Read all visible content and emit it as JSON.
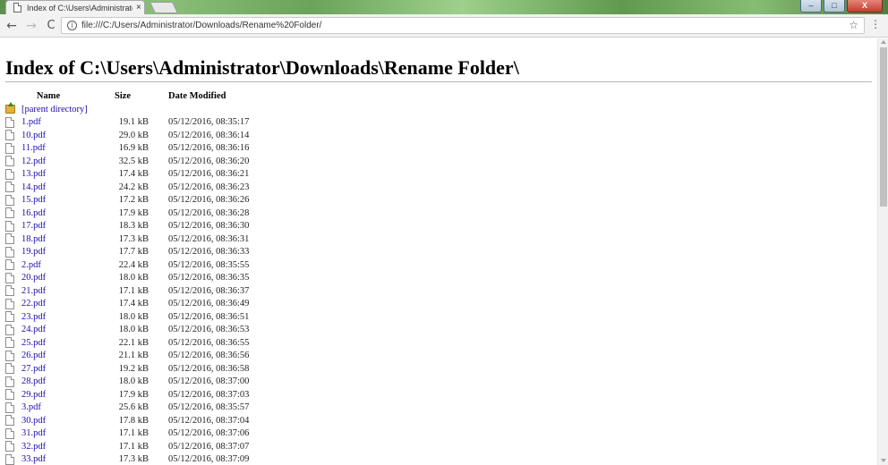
{
  "browser": {
    "tab_title": "Index of C:\\Users\\Administrator",
    "tab_close": "×",
    "url": "file:///C:/Users/Administrator/Downloads/Rename%20Folder/",
    "back": "←",
    "forward": "→",
    "reload": "C",
    "info": "i",
    "star": "☆",
    "menu": "⋮",
    "controls": {
      "minimize": "–",
      "maximize": "□",
      "close": "X"
    }
  },
  "page": {
    "heading": "Index of C:\\Users\\Administrator\\Downloads\\Rename Folder\\",
    "columns": {
      "name": "Name",
      "size": "Size",
      "date": "Date Modified"
    },
    "parent_link": "[parent directory]",
    "files": [
      {
        "name": "1.pdf",
        "size": "19.1 kB",
        "date": "05/12/2016, 08:35:17"
      },
      {
        "name": "10.pdf",
        "size": "29.0 kB",
        "date": "05/12/2016, 08:36:14"
      },
      {
        "name": "11.pdf",
        "size": "16.9 kB",
        "date": "05/12/2016, 08:36:16"
      },
      {
        "name": "12.pdf",
        "size": "32.5 kB",
        "date": "05/12/2016, 08:36:20"
      },
      {
        "name": "13.pdf",
        "size": "17.4 kB",
        "date": "05/12/2016, 08:36:21"
      },
      {
        "name": "14.pdf",
        "size": "24.2 kB",
        "date": "05/12/2016, 08:36:23"
      },
      {
        "name": "15.pdf",
        "size": "17.2 kB",
        "date": "05/12/2016, 08:36:26"
      },
      {
        "name": "16.pdf",
        "size": "17.9 kB",
        "date": "05/12/2016, 08:36:28"
      },
      {
        "name": "17.pdf",
        "size": "18.3 kB",
        "date": "05/12/2016, 08:36:30"
      },
      {
        "name": "18.pdf",
        "size": "17.3 kB",
        "date": "05/12/2016, 08:36:31"
      },
      {
        "name": "19.pdf",
        "size": "17.7 kB",
        "date": "05/12/2016, 08:36:33"
      },
      {
        "name": "2.pdf",
        "size": "22.4 kB",
        "date": "05/12/2016, 08:35:55"
      },
      {
        "name": "20.pdf",
        "size": "18.0 kB",
        "date": "05/12/2016, 08:36:35"
      },
      {
        "name": "21.pdf",
        "size": "17.1 kB",
        "date": "05/12/2016, 08:36:37"
      },
      {
        "name": "22.pdf",
        "size": "17.4 kB",
        "date": "05/12/2016, 08:36:49"
      },
      {
        "name": "23.pdf",
        "size": "18.0 kB",
        "date": "05/12/2016, 08:36:51"
      },
      {
        "name": "24.pdf",
        "size": "18.0 kB",
        "date": "05/12/2016, 08:36:53"
      },
      {
        "name": "25.pdf",
        "size": "22.1 kB",
        "date": "05/12/2016, 08:36:55"
      },
      {
        "name": "26.pdf",
        "size": "21.1 kB",
        "date": "05/12/2016, 08:36:56"
      },
      {
        "name": "27.pdf",
        "size": "19.2 kB",
        "date": "05/12/2016, 08:36:58"
      },
      {
        "name": "28.pdf",
        "size": "18.0 kB",
        "date": "05/12/2016, 08:37:00"
      },
      {
        "name": "29.pdf",
        "size": "17.9 kB",
        "date": "05/12/2016, 08:37:03"
      },
      {
        "name": "3.pdf",
        "size": "25.6 kB",
        "date": "05/12/2016, 08:35:57"
      },
      {
        "name": "30.pdf",
        "size": "17.8 kB",
        "date": "05/12/2016, 08:37:04"
      },
      {
        "name": "31.pdf",
        "size": "17.1 kB",
        "date": "05/12/2016, 08:37:06"
      },
      {
        "name": "32.pdf",
        "size": "17.1 kB",
        "date": "05/12/2016, 08:37:07"
      },
      {
        "name": "33.pdf",
        "size": "17.3 kB",
        "date": "05/12/2016, 08:37:09"
      }
    ]
  },
  "colors": {
    "link": "#1a0dab",
    "rule": "#b5b5b5"
  }
}
